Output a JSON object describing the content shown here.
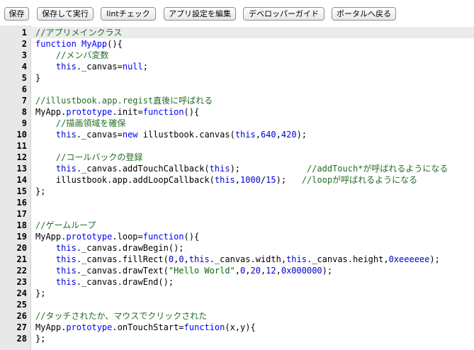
{
  "toolbar": {
    "buttons": [
      {
        "label": "保存"
      },
      {
        "label": "保存して実行"
      },
      {
        "label": "lintチェック"
      },
      {
        "label": "アプリ設定を編集"
      },
      {
        "label": "デベロッパーガイド"
      },
      {
        "label": "ポータルへ戻る"
      }
    ]
  },
  "editor": {
    "active_line": 1,
    "lines": [
      {
        "num": "1",
        "tokens": [
          {
            "t": "comment",
            "v": "//アプリメインクラス"
          }
        ]
      },
      {
        "num": "2",
        "tokens": [
          {
            "t": "keyword",
            "v": "function"
          },
          {
            "t": "plain",
            "v": " "
          },
          {
            "t": "keyword",
            "v": "MyApp"
          },
          {
            "t": "plain",
            "v": "(){"
          }
        ]
      },
      {
        "num": "3",
        "tokens": [
          {
            "t": "plain",
            "v": "    "
          },
          {
            "t": "comment",
            "v": "//メンバ変数"
          }
        ]
      },
      {
        "num": "4",
        "tokens": [
          {
            "t": "plain",
            "v": "    "
          },
          {
            "t": "this",
            "v": "this"
          },
          {
            "t": "plain",
            "v": "._canvas="
          },
          {
            "t": "keyword",
            "v": "null"
          },
          {
            "t": "plain",
            "v": ";"
          }
        ]
      },
      {
        "num": "5",
        "tokens": [
          {
            "t": "plain",
            "v": "}"
          }
        ]
      },
      {
        "num": "6",
        "tokens": []
      },
      {
        "num": "7",
        "tokens": [
          {
            "t": "comment",
            "v": "//illustbook.app.regist直後に呼ばれる"
          }
        ]
      },
      {
        "num": "8",
        "tokens": [
          {
            "t": "plain",
            "v": "MyApp."
          },
          {
            "t": "keyword",
            "v": "prototype"
          },
          {
            "t": "plain",
            "v": ".init="
          },
          {
            "t": "keyword",
            "v": "function"
          },
          {
            "t": "plain",
            "v": "(){"
          }
        ]
      },
      {
        "num": "9",
        "tokens": [
          {
            "t": "plain",
            "v": "    "
          },
          {
            "t": "comment",
            "v": "//描画領域を確保"
          }
        ]
      },
      {
        "num": "10",
        "tokens": [
          {
            "t": "plain",
            "v": "    "
          },
          {
            "t": "this",
            "v": "this"
          },
          {
            "t": "plain",
            "v": "._canvas="
          },
          {
            "t": "keyword",
            "v": "new"
          },
          {
            "t": "plain",
            "v": " illustbook.canvas("
          },
          {
            "t": "this",
            "v": "this"
          },
          {
            "t": "plain",
            "v": ","
          },
          {
            "t": "number",
            "v": "640"
          },
          {
            "t": "plain",
            "v": ","
          },
          {
            "t": "number",
            "v": "420"
          },
          {
            "t": "plain",
            "v": ");"
          }
        ]
      },
      {
        "num": "11",
        "tokens": []
      },
      {
        "num": "12",
        "tokens": [
          {
            "t": "plain",
            "v": "    "
          },
          {
            "t": "comment",
            "v": "//コールバックの登録"
          }
        ]
      },
      {
        "num": "13",
        "tokens": [
          {
            "t": "plain",
            "v": "    "
          },
          {
            "t": "this",
            "v": "this"
          },
          {
            "t": "plain",
            "v": "._canvas.addTouchCallback("
          },
          {
            "t": "this",
            "v": "this"
          },
          {
            "t": "plain",
            "v": ");             "
          },
          {
            "t": "comment",
            "v": "//addTouch*が呼ばれるようになる"
          }
        ]
      },
      {
        "num": "14",
        "tokens": [
          {
            "t": "plain",
            "v": "    illustbook.app.addLoopCallback("
          },
          {
            "t": "this",
            "v": "this"
          },
          {
            "t": "plain",
            "v": ","
          },
          {
            "t": "number",
            "v": "1000"
          },
          {
            "t": "plain",
            "v": "/"
          },
          {
            "t": "number",
            "v": "15"
          },
          {
            "t": "plain",
            "v": ");   "
          },
          {
            "t": "comment",
            "v": "//loopが呼ばれるようになる"
          }
        ]
      },
      {
        "num": "15",
        "tokens": [
          {
            "t": "plain",
            "v": "};"
          }
        ]
      },
      {
        "num": "16",
        "tokens": []
      },
      {
        "num": "17",
        "tokens": []
      },
      {
        "num": "18",
        "tokens": [
          {
            "t": "comment",
            "v": "//ゲームループ"
          }
        ]
      },
      {
        "num": "19",
        "tokens": [
          {
            "t": "plain",
            "v": "MyApp."
          },
          {
            "t": "keyword",
            "v": "prototype"
          },
          {
            "t": "plain",
            "v": ".loop="
          },
          {
            "t": "keyword",
            "v": "function"
          },
          {
            "t": "plain",
            "v": "(){"
          }
        ]
      },
      {
        "num": "20",
        "tokens": [
          {
            "t": "plain",
            "v": "    "
          },
          {
            "t": "this",
            "v": "this"
          },
          {
            "t": "plain",
            "v": "._canvas.drawBegin();"
          }
        ]
      },
      {
        "num": "21",
        "tokens": [
          {
            "t": "plain",
            "v": "    "
          },
          {
            "t": "this",
            "v": "this"
          },
          {
            "t": "plain",
            "v": "._canvas.fillRect("
          },
          {
            "t": "number",
            "v": "0"
          },
          {
            "t": "plain",
            "v": ","
          },
          {
            "t": "number",
            "v": "0"
          },
          {
            "t": "plain",
            "v": ","
          },
          {
            "t": "this",
            "v": "this"
          },
          {
            "t": "plain",
            "v": "._canvas.width,"
          },
          {
            "t": "this",
            "v": "this"
          },
          {
            "t": "plain",
            "v": "._canvas.height,"
          },
          {
            "t": "number",
            "v": "0xeeeeee"
          },
          {
            "t": "plain",
            "v": ");"
          }
        ]
      },
      {
        "num": "22",
        "tokens": [
          {
            "t": "plain",
            "v": "    "
          },
          {
            "t": "this",
            "v": "this"
          },
          {
            "t": "plain",
            "v": "._canvas.drawText("
          },
          {
            "t": "string",
            "v": "\"Hello World\""
          },
          {
            "t": "plain",
            "v": ","
          },
          {
            "t": "number",
            "v": "0"
          },
          {
            "t": "plain",
            "v": ","
          },
          {
            "t": "number",
            "v": "20"
          },
          {
            "t": "plain",
            "v": ","
          },
          {
            "t": "number",
            "v": "12"
          },
          {
            "t": "plain",
            "v": ","
          },
          {
            "t": "number",
            "v": "0x000000"
          },
          {
            "t": "plain",
            "v": ");"
          }
        ]
      },
      {
        "num": "23",
        "tokens": [
          {
            "t": "plain",
            "v": "    "
          },
          {
            "t": "this",
            "v": "this"
          },
          {
            "t": "plain",
            "v": "._canvas.drawEnd();"
          }
        ]
      },
      {
        "num": "24",
        "tokens": [
          {
            "t": "plain",
            "v": "};"
          }
        ]
      },
      {
        "num": "25",
        "tokens": []
      },
      {
        "num": "26",
        "tokens": [
          {
            "t": "comment",
            "v": "//タッチされたか、マウスでクリックされた"
          }
        ]
      },
      {
        "num": "27",
        "tokens": [
          {
            "t": "plain",
            "v": "MyApp."
          },
          {
            "t": "keyword",
            "v": "prototype"
          },
          {
            "t": "plain",
            "v": ".onTouchStart="
          },
          {
            "t": "keyword",
            "v": "function"
          },
          {
            "t": "plain",
            "v": "(x,y){"
          }
        ]
      },
      {
        "num": "28",
        "tokens": [
          {
            "t": "plain",
            "v": "};"
          }
        ]
      }
    ]
  },
  "colors": {
    "comment": "#236e25",
    "keyword": "#0000ff",
    "this": "#0000cc",
    "number": "#0000cd",
    "string": "#036a07",
    "gutter_bg": "#e8e8e8",
    "active_line_bg": "#ebebeb"
  }
}
